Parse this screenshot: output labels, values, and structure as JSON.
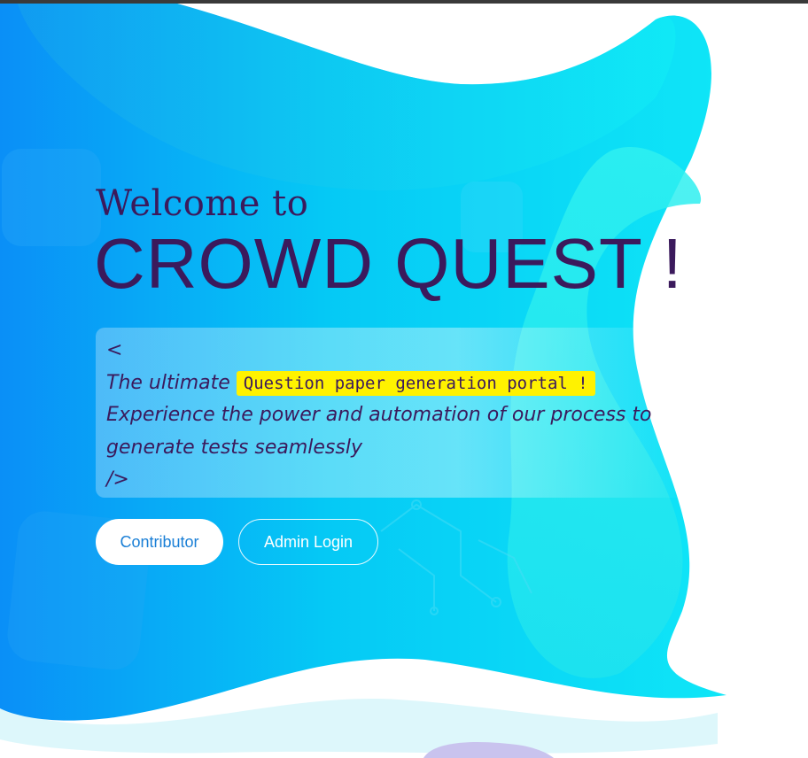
{
  "hero": {
    "welcome": "Welcome to",
    "brand": "CROWD QUEST !"
  },
  "tagline": {
    "open_tag": "<",
    "prefix": "The ultimate ",
    "highlight": "Question paper generation portal !",
    "line2": "Experience the power and automation of our process to",
    "line3": "generate tests seamlessly",
    "close_tag": "/>"
  },
  "buttons": {
    "contributor": "Contributor",
    "admin_login": "Admin Login"
  },
  "colors": {
    "heading": "#3b1a5c",
    "highlight": "#fff200",
    "accent_button_text": "#1a7fd6"
  }
}
